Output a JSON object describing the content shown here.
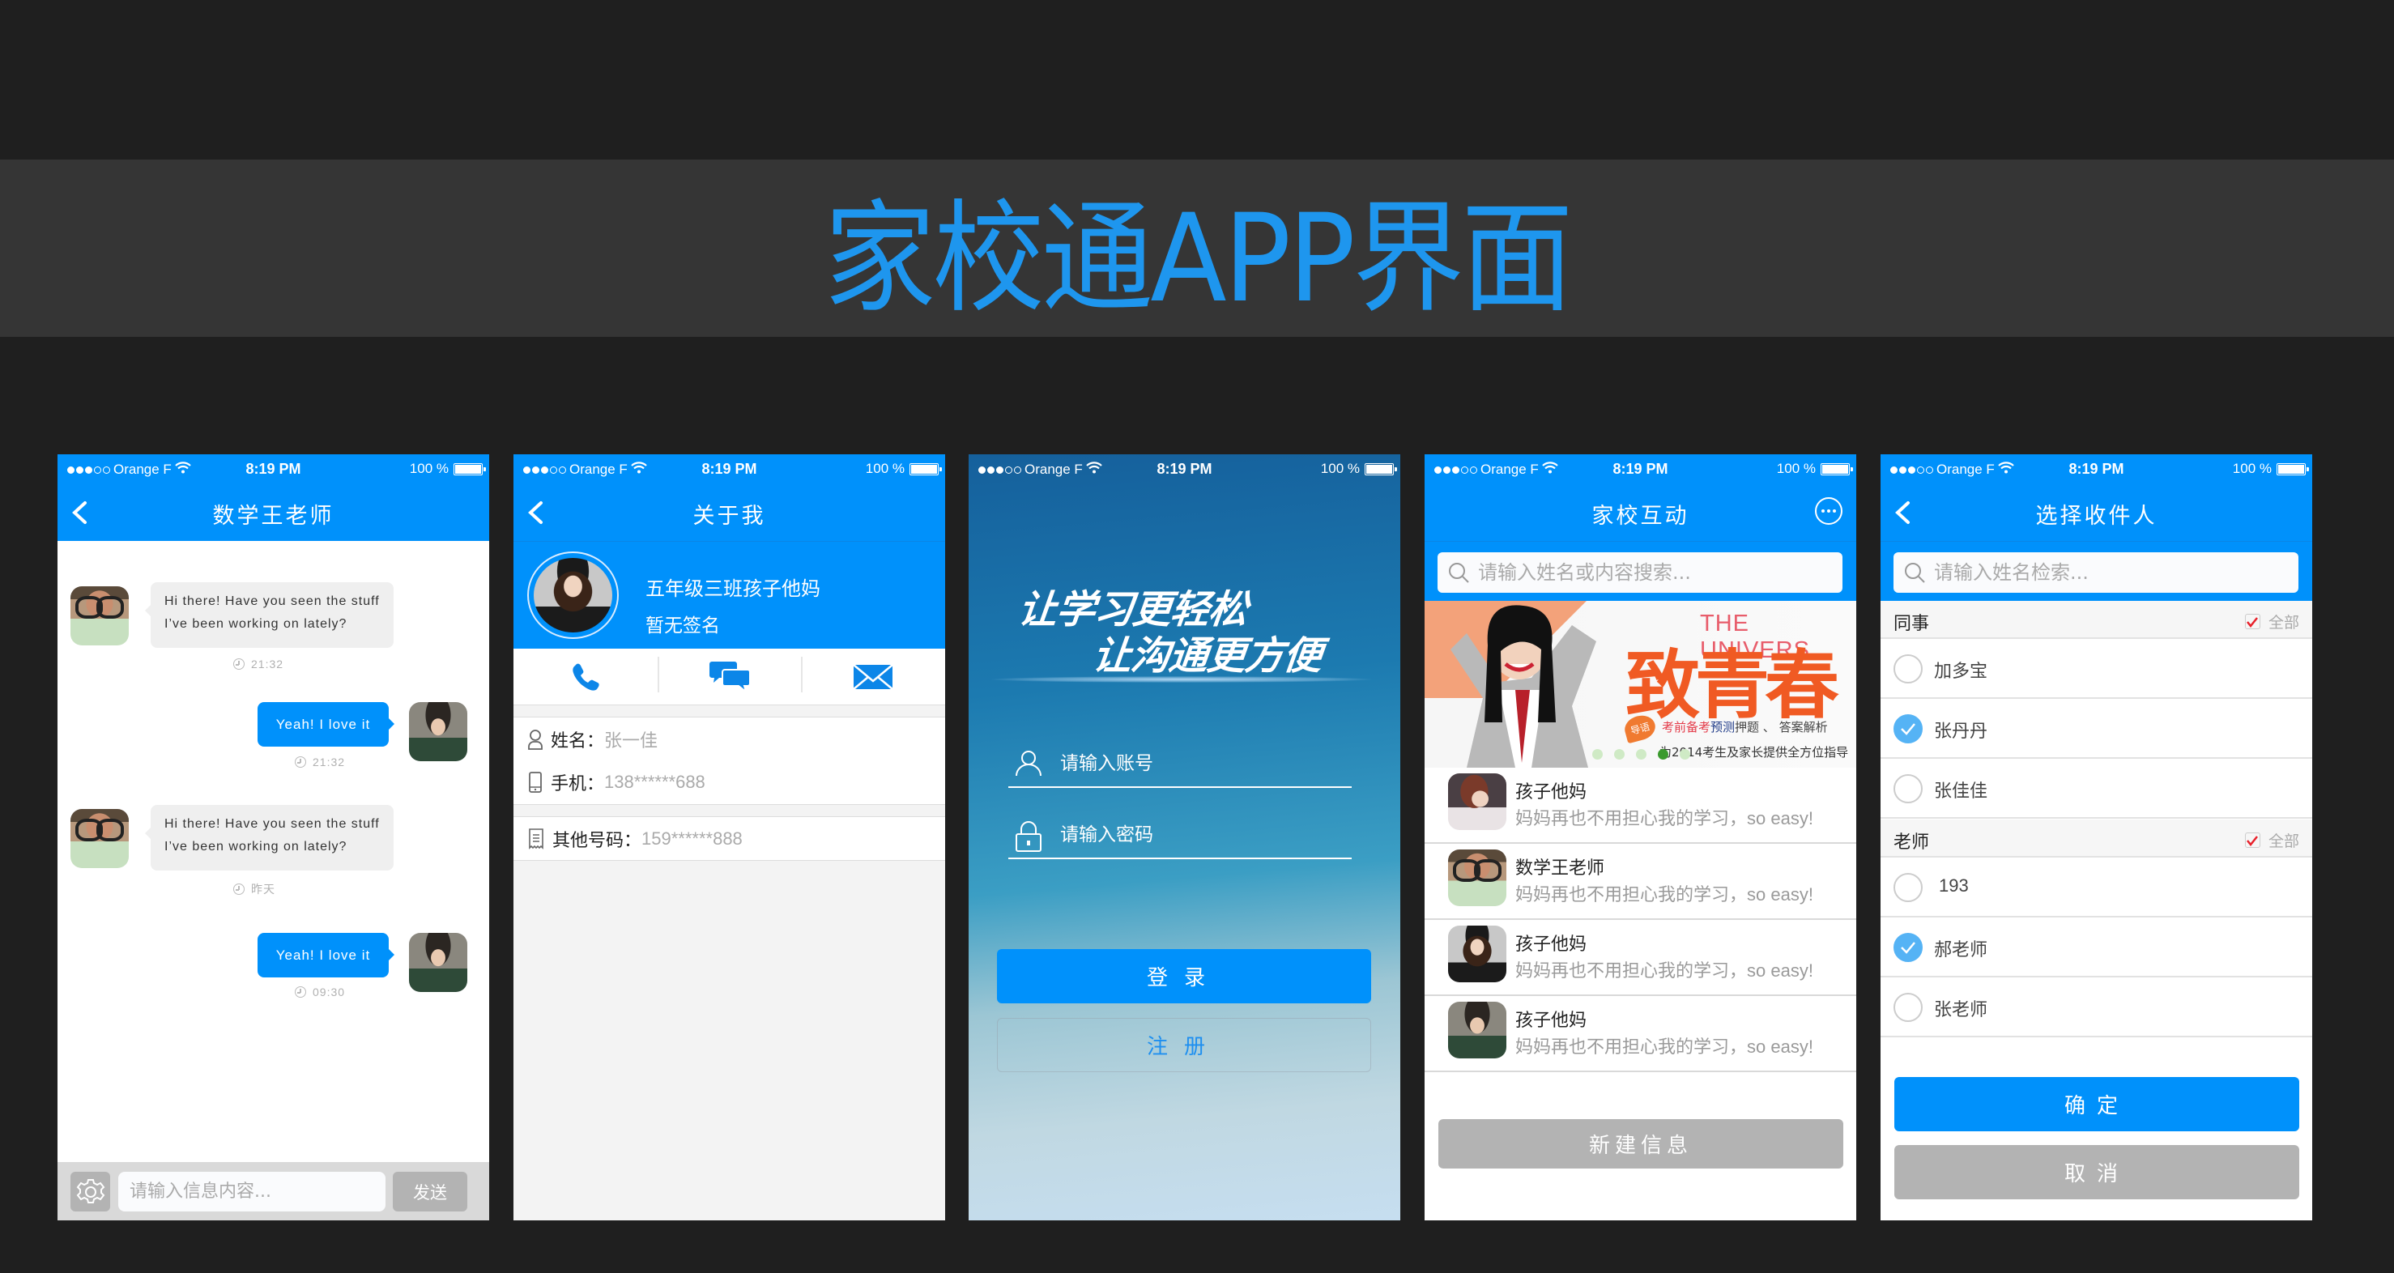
{
  "banner": {
    "title": "家校通APP界面"
  },
  "status_bar": {
    "carrier": "Orange F",
    "time": "8:19 PM",
    "battery": "100 %",
    "signal_bars_filled": 3,
    "signal_bars_total": 5,
    "battery_level_percent": 100
  },
  "colors": {
    "primary": "#0091fb",
    "title": "#1e96ee",
    "gray_button": "#b3b3b3",
    "check_blue": "#55b3f5",
    "banner_orange": "#f05a23"
  },
  "chat": {
    "title": "数学王老师",
    "messages": [
      {
        "direction": "in",
        "line1": "Hi there! Have you seen the stuff",
        "line2": "I’ve been working on lately?",
        "time": "21:32"
      },
      {
        "direction": "out",
        "text": "Yeah! I love it",
        "time": "21:32"
      },
      {
        "direction": "in",
        "line1": "Hi there! Have you seen the stuff",
        "line2": "I’ve been working on lately?",
        "time": "昨天"
      },
      {
        "direction": "out",
        "text": "Yeah! I love it",
        "time": "09:30"
      }
    ],
    "input_placeholder": "请输入信息内容...",
    "send_label": "发送"
  },
  "about": {
    "title": "关于我",
    "name": "五年级三班孩子他妈",
    "signature": "暂无签名",
    "fields": [
      {
        "label": "姓名：",
        "value": "张一佳"
      },
      {
        "label": "手机：",
        "value": "138******688"
      },
      {
        "label": "其他号码：",
        "value": "159******888"
      }
    ]
  },
  "login": {
    "slogan_line1": "让学习更轻松",
    "slogan_line2": "让沟通更方便",
    "account_placeholder": "请输入账号",
    "password_placeholder": "请输入密码",
    "login_label": "登录",
    "register_label": "注册"
  },
  "interact": {
    "title": "家校互动",
    "search_placeholder": "请输入姓名或内容搜索...",
    "banner": {
      "english": "THE UNIVERS",
      "headline": "致青春",
      "tag": "导语",
      "line1_red": "考前备考",
      "line1_blue": "预测",
      "line1_rest": "押题 、 答案解析",
      "line2": "为2014考生及家长提供全方位指导",
      "dots_total": 5,
      "active_dot": 4
    },
    "items": [
      {
        "name": "孩子他妈",
        "preview_cn": "妈妈再也不用担心我的学习，",
        "preview_en": "so easy!",
        "avatar": "short-hair-avatar"
      },
      {
        "name": "数学王老师",
        "preview_cn": "妈妈再也不用担心我的学习，",
        "preview_en": "so easy!",
        "avatar": "glasses-avatar"
      },
      {
        "name": "孩子他妈",
        "preview_cn": "妈妈再也不用担心我的学习，",
        "preview_en": "so easy!",
        "avatar": "curly-hair-avatar"
      },
      {
        "name": "孩子他妈",
        "preview_cn": "妈妈再也不用担心我的学习，",
        "preview_en": "so easy!",
        "avatar": "hat-avatar"
      }
    ],
    "new_message_label": "新建信息"
  },
  "recipients": {
    "title": "选择收件人",
    "search_placeholder": "请输入姓名检索...",
    "groups": [
      {
        "name": "同事",
        "all_label": "全部",
        "all_checked": true,
        "members": [
          {
            "name": "加多宝",
            "checked": false
          },
          {
            "name": "张丹丹",
            "checked": true
          },
          {
            "name": "张佳佳",
            "checked": false
          }
        ]
      },
      {
        "name": "老师",
        "all_label": "全部",
        "all_checked": true,
        "members": [
          {
            "name": "193",
            "checked": false
          },
          {
            "name": "郝老师",
            "checked": true
          },
          {
            "name": "张老师",
            "checked": false
          }
        ]
      }
    ],
    "confirm_label": "确定",
    "cancel_label": "取消"
  }
}
